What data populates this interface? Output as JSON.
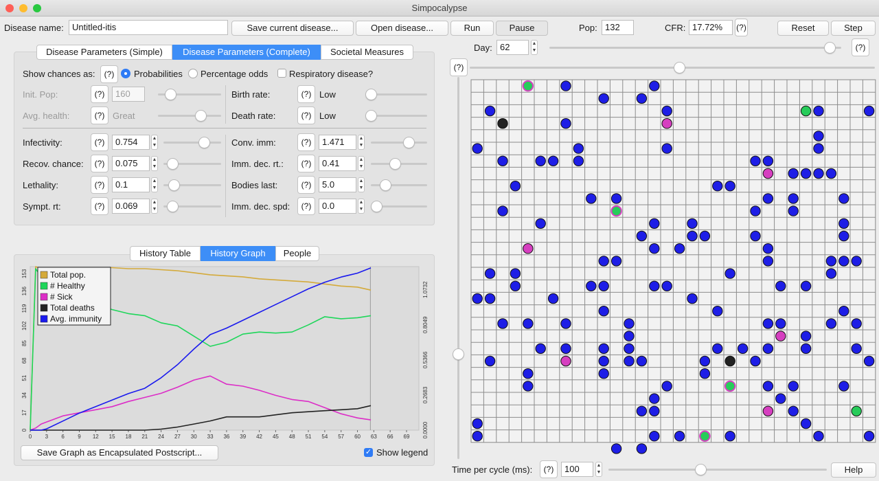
{
  "window": {
    "title": "Simpocalypse",
    "close_color": "#fe5f57",
    "min_color": "#febc2e",
    "max_color": "#28c840"
  },
  "toolbar": {
    "disease_name_label": "Disease name:",
    "disease_name_value": "Untitled-itis",
    "save_label": "Save current disease...",
    "open_label": "Open disease...",
    "run_label": "Run",
    "pause_label": "Pause",
    "pop_label": "Pop:",
    "pop_value": "132",
    "cfr_label": "CFR:",
    "cfr_value": "17.72%",
    "help_q": "(?)",
    "reset_label": "Reset",
    "step_label": "Step"
  },
  "tabs": {
    "simple": "Disease Parameters (Simple)",
    "complete": "Disease Parameters (Complete)",
    "societal": "Societal Measures"
  },
  "params": {
    "show_chances_label": "Show chances as:",
    "q": "(?)",
    "probabilities": "Probabilities",
    "percentage_odds": "Percentage odds",
    "respiratory": "Respiratory disease?",
    "init_pop_label": "Init. Pop:",
    "init_pop_value": "160",
    "avg_health_label": "Avg. health:",
    "avg_health_value": "Great",
    "birth_rate_label": "Birth rate:",
    "birth_rate_value": "Low",
    "death_rate_label": "Death rate:",
    "death_rate_value": "Low",
    "rows": [
      {
        "label": "Infectivity:",
        "value": "0.754",
        "level": 0.754
      },
      {
        "label": "Recov. chance:",
        "value": "0.075",
        "level": 0.075
      },
      {
        "label": "Lethality:",
        "value": "0.1",
        "level": 0.1
      },
      {
        "label": "Sympt. rt:",
        "value": "0.069",
        "level": 0.069
      }
    ],
    "rows_right": [
      {
        "label": "Conv. imm:",
        "value": "1.471",
        "level": 0.73
      },
      {
        "label": "Imm. dec. rt.:",
        "value": "0.41",
        "level": 0.41
      },
      {
        "label": "Bodies last:",
        "value": "5.0",
        "level": 0.2
      },
      {
        "label": "Imm. dec. spd:",
        "value": "0.0",
        "level": 0.0
      }
    ]
  },
  "history_tabs": {
    "table": "History Table",
    "graph": "History Graph",
    "people": "People"
  },
  "chart_data": {
    "type": "line",
    "x_ticks": [
      "0",
      "3",
      "6",
      "9",
      "12",
      "15",
      "18",
      "21",
      "24",
      "27",
      "30",
      "33",
      "36",
      "39",
      "42",
      "45",
      "48",
      "51",
      "54",
      "57",
      "60",
      "63",
      "66",
      "69"
    ],
    "left_ticks": [
      "0",
      "17",
      "34",
      "51",
      "68",
      "85",
      "102",
      "119",
      "136",
      "153"
    ],
    "right_ticks": [
      "0.0000",
      "0.2683",
      "0.5366",
      "0.8049",
      "1.0732"
    ],
    "xlim": [
      0,
      69
    ],
    "ylim_left": [
      0,
      160
    ],
    "ylim_right": [
      0,
      1.25
    ],
    "legend_position": "top-left",
    "series": [
      {
        "name": "Total pop.",
        "color": "#d4aa3a",
        "axis": "left",
        "x": [
          0,
          1,
          2,
          3,
          6,
          9,
          12,
          15,
          18,
          21,
          24,
          27,
          30,
          33,
          36,
          39,
          42,
          45,
          48,
          51,
          54,
          57,
          60,
          63
        ],
        "values": [
          0,
          160,
          158,
          159,
          159,
          159,
          159,
          159,
          158,
          158,
          157,
          156,
          154,
          152,
          151,
          150,
          148,
          147,
          146,
          145,
          143,
          141,
          140,
          137
        ]
      },
      {
        "name": "# Healthy",
        "color": "#1ed65a",
        "axis": "left",
        "x": [
          0,
          1,
          2,
          3,
          6,
          9,
          12,
          15,
          18,
          21,
          24,
          27,
          30,
          33,
          36,
          39,
          42,
          45,
          48,
          51,
          54,
          57,
          60,
          63
        ],
        "values": [
          0,
          158,
          150,
          145,
          135,
          128,
          123,
          118,
          114,
          112,
          105,
          102,
          92,
          82,
          86,
          94,
          96,
          95,
          96,
          103,
          111,
          109,
          110,
          112
        ]
      },
      {
        "name": "# Sick",
        "color": "#dc2dc7",
        "axis": "left",
        "x": [
          0,
          1,
          2,
          3,
          6,
          9,
          12,
          15,
          18,
          21,
          24,
          27,
          30,
          33,
          36,
          39,
          42,
          45,
          48,
          51,
          54,
          57,
          60,
          63
        ],
        "values": [
          0,
          2,
          6,
          8,
          14,
          17,
          20,
          23,
          28,
          32,
          36,
          42,
          49,
          53,
          45,
          43,
          39,
          34,
          30,
          28,
          22,
          16,
          12,
          10
        ]
      },
      {
        "name": "Total deaths",
        "color": "#222222",
        "axis": "left",
        "x": [
          0,
          1,
          2,
          3,
          6,
          9,
          12,
          15,
          18,
          21,
          24,
          27,
          30,
          33,
          36,
          39,
          42,
          45,
          48,
          51,
          54,
          57,
          60,
          63
        ],
        "values": [
          0,
          0,
          0,
          0,
          0,
          0,
          0,
          0,
          0,
          0,
          1,
          3,
          6,
          9,
          13,
          13,
          13,
          15,
          17,
          18,
          19,
          20,
          21,
          24
        ]
      },
      {
        "name": "Avg. immunity",
        "color": "#1a1aee",
        "axis": "right",
        "x": [
          0,
          1,
          2,
          3,
          6,
          9,
          12,
          15,
          18,
          21,
          24,
          27,
          30,
          33,
          36,
          39,
          42,
          45,
          48,
          51,
          54,
          57,
          60,
          63
        ],
        "values": [
          0,
          0,
          0,
          0.01,
          0.07,
          0.13,
          0.18,
          0.23,
          0.28,
          0.32,
          0.4,
          0.5,
          0.62,
          0.73,
          0.78,
          0.84,
          0.9,
          0.96,
          1.02,
          1.08,
          1.13,
          1.17,
          1.2,
          1.24
        ]
      }
    ]
  },
  "graph_footer": {
    "save_eps": "Save Graph as Encapsulated Postscript...",
    "show_legend": "Show legend"
  },
  "right_top": {
    "day_label": "Day:",
    "day_value": "62",
    "day_level": 0.98,
    "q": "(?)",
    "zoom_q": "(?)"
  },
  "grid": {
    "cols": 32,
    "rows": 29,
    "colors": {
      "healthy": "#1e1ee6",
      "sick": "#d63fc0",
      "recovered": "#27cc5a",
      "dead": "#222222",
      "ring_sick": "#d63fc0"
    },
    "people": [
      {
        "c": 4,
        "r": 0,
        "t": "rec"
      },
      {
        "c": 7,
        "r": 0,
        "t": "h"
      },
      {
        "c": 14,
        "r": 0,
        "t": "h"
      },
      {
        "c": 10,
        "r": 1,
        "t": "h"
      },
      {
        "c": 13,
        "r": 1,
        "t": "h"
      },
      {
        "c": 1,
        "r": 2,
        "t": "h"
      },
      {
        "c": 15,
        "r": 2,
        "t": "h"
      },
      {
        "c": 26,
        "r": 2,
        "t": "g"
      },
      {
        "c": 27,
        "r": 2,
        "t": "h"
      },
      {
        "c": 31,
        "r": 2,
        "t": "h"
      },
      {
        "c": 2,
        "r": 3,
        "t": "d"
      },
      {
        "c": 7,
        "r": 3,
        "t": "h"
      },
      {
        "c": 15,
        "r": 3,
        "t": "s"
      },
      {
        "c": 27,
        "r": 4,
        "t": "h"
      },
      {
        "c": 0,
        "r": 5,
        "t": "h"
      },
      {
        "c": 8,
        "r": 5,
        "t": "h"
      },
      {
        "c": 15,
        "r": 5,
        "t": "h"
      },
      {
        "c": 27,
        "r": 5,
        "t": "h"
      },
      {
        "c": 2,
        "r": 6,
        "t": "h"
      },
      {
        "c": 5,
        "r": 6,
        "t": "h"
      },
      {
        "c": 6,
        "r": 6,
        "t": "h"
      },
      {
        "c": 8,
        "r": 6,
        "t": "h"
      },
      {
        "c": 22,
        "r": 6,
        "t": "h"
      },
      {
        "c": 23,
        "r": 6,
        "t": "h"
      },
      {
        "c": 23,
        "r": 7,
        "t": "s"
      },
      {
        "c": 25,
        "r": 7,
        "t": "h"
      },
      {
        "c": 26,
        "r": 7,
        "t": "h"
      },
      {
        "c": 27,
        "r": 7,
        "t": "h"
      },
      {
        "c": 28,
        "r": 7,
        "t": "h"
      },
      {
        "c": 3,
        "r": 8,
        "t": "h"
      },
      {
        "c": 19,
        "r": 8,
        "t": "h"
      },
      {
        "c": 20,
        "r": 8,
        "t": "h"
      },
      {
        "c": 9,
        "r": 9,
        "t": "h"
      },
      {
        "c": 11,
        "r": 9,
        "t": "h"
      },
      {
        "c": 23,
        "r": 9,
        "t": "h"
      },
      {
        "c": 25,
        "r": 9,
        "t": "h"
      },
      {
        "c": 29,
        "r": 9,
        "t": "h"
      },
      {
        "c": 2,
        "r": 10,
        "t": "h"
      },
      {
        "c": 11,
        "r": 10,
        "t": "rec"
      },
      {
        "c": 22,
        "r": 10,
        "t": "h"
      },
      {
        "c": 25,
        "r": 10,
        "t": "h"
      },
      {
        "c": 5,
        "r": 11,
        "t": "h"
      },
      {
        "c": 14,
        "r": 11,
        "t": "h"
      },
      {
        "c": 17,
        "r": 11,
        "t": "h"
      },
      {
        "c": 29,
        "r": 11,
        "t": "h"
      },
      {
        "c": 13,
        "r": 12,
        "t": "h"
      },
      {
        "c": 17,
        "r": 12,
        "t": "h"
      },
      {
        "c": 18,
        "r": 12,
        "t": "h"
      },
      {
        "c": 22,
        "r": 12,
        "t": "h"
      },
      {
        "c": 29,
        "r": 12,
        "t": "h"
      },
      {
        "c": 4,
        "r": 13,
        "t": "s"
      },
      {
        "c": 14,
        "r": 13,
        "t": "h"
      },
      {
        "c": 16,
        "r": 13,
        "t": "h"
      },
      {
        "c": 23,
        "r": 13,
        "t": "h"
      },
      {
        "c": 10,
        "r": 14,
        "t": "h"
      },
      {
        "c": 11,
        "r": 14,
        "t": "h"
      },
      {
        "c": 23,
        "r": 14,
        "t": "h"
      },
      {
        "c": 28,
        "r": 14,
        "t": "h"
      },
      {
        "c": 29,
        "r": 14,
        "t": "h"
      },
      {
        "c": 30,
        "r": 14,
        "t": "h"
      },
      {
        "c": 1,
        "r": 15,
        "t": "h"
      },
      {
        "c": 3,
        "r": 15,
        "t": "h"
      },
      {
        "c": 20,
        "r": 15,
        "t": "h"
      },
      {
        "c": 28,
        "r": 15,
        "t": "h"
      },
      {
        "c": 3,
        "r": 16,
        "t": "h"
      },
      {
        "c": 9,
        "r": 16,
        "t": "h"
      },
      {
        "c": 10,
        "r": 16,
        "t": "h"
      },
      {
        "c": 14,
        "r": 16,
        "t": "h"
      },
      {
        "c": 15,
        "r": 16,
        "t": "h"
      },
      {
        "c": 24,
        "r": 16,
        "t": "h"
      },
      {
        "c": 26,
        "r": 16,
        "t": "h"
      },
      {
        "c": 0,
        "r": 17,
        "t": "h"
      },
      {
        "c": 1,
        "r": 17,
        "t": "h"
      },
      {
        "c": 6,
        "r": 17,
        "t": "h"
      },
      {
        "c": 17,
        "r": 17,
        "t": "h"
      },
      {
        "c": 10,
        "r": 18,
        "t": "h"
      },
      {
        "c": 19,
        "r": 18,
        "t": "h"
      },
      {
        "c": 29,
        "r": 18,
        "t": "h"
      },
      {
        "c": 2,
        "r": 19,
        "t": "h"
      },
      {
        "c": 4,
        "r": 19,
        "t": "h"
      },
      {
        "c": 7,
        "r": 19,
        "t": "h"
      },
      {
        "c": 12,
        "r": 19,
        "t": "h"
      },
      {
        "c": 23,
        "r": 19,
        "t": "h"
      },
      {
        "c": 24,
        "r": 19,
        "t": "h"
      },
      {
        "c": 28,
        "r": 19,
        "t": "h"
      },
      {
        "c": 30,
        "r": 19,
        "t": "h"
      },
      {
        "c": 12,
        "r": 20,
        "t": "h"
      },
      {
        "c": 24,
        "r": 20,
        "t": "s"
      },
      {
        "c": 26,
        "r": 20,
        "t": "h"
      },
      {
        "c": 5,
        "r": 21,
        "t": "h"
      },
      {
        "c": 7,
        "r": 21,
        "t": "h"
      },
      {
        "c": 10,
        "r": 21,
        "t": "h"
      },
      {
        "c": 12,
        "r": 21,
        "t": "h"
      },
      {
        "c": 19,
        "r": 21,
        "t": "h"
      },
      {
        "c": 21,
        "r": 21,
        "t": "h"
      },
      {
        "c": 23,
        "r": 21,
        "t": "h"
      },
      {
        "c": 26,
        "r": 21,
        "t": "h"
      },
      {
        "c": 30,
        "r": 21,
        "t": "h"
      },
      {
        "c": 1,
        "r": 22,
        "t": "h"
      },
      {
        "c": 7,
        "r": 22,
        "t": "s"
      },
      {
        "c": 10,
        "r": 22,
        "t": "h"
      },
      {
        "c": 12,
        "r": 22,
        "t": "h"
      },
      {
        "c": 13,
        "r": 22,
        "t": "h"
      },
      {
        "c": 18,
        "r": 22,
        "t": "h"
      },
      {
        "c": 20,
        "r": 22,
        "t": "d"
      },
      {
        "c": 22,
        "r": 22,
        "t": "h"
      },
      {
        "c": 31,
        "r": 22,
        "t": "h"
      },
      {
        "c": 4,
        "r": 23,
        "t": "h"
      },
      {
        "c": 10,
        "r": 23,
        "t": "h"
      },
      {
        "c": 18,
        "r": 23,
        "t": "h"
      },
      {
        "c": 4,
        "r": 24,
        "t": "h"
      },
      {
        "c": 15,
        "r": 24,
        "t": "h"
      },
      {
        "c": 20,
        "r": 24,
        "t": "rec"
      },
      {
        "c": 23,
        "r": 24,
        "t": "h"
      },
      {
        "c": 25,
        "r": 24,
        "t": "h"
      },
      {
        "c": 29,
        "r": 24,
        "t": "h"
      },
      {
        "c": 14,
        "r": 25,
        "t": "h"
      },
      {
        "c": 24,
        "r": 25,
        "t": "h"
      },
      {
        "c": 13,
        "r": 26,
        "t": "h"
      },
      {
        "c": 14,
        "r": 26,
        "t": "h"
      },
      {
        "c": 23,
        "r": 26,
        "t": "s"
      },
      {
        "c": 25,
        "r": 26,
        "t": "h"
      },
      {
        "c": 30,
        "r": 26,
        "t": "g"
      },
      {
        "c": 0,
        "r": 27,
        "t": "h"
      },
      {
        "c": 26,
        "r": 27,
        "t": "h"
      },
      {
        "c": 0,
        "r": 28,
        "t": "h"
      },
      {
        "c": 14,
        "r": 28,
        "t": "h"
      },
      {
        "c": 16,
        "r": 28,
        "t": "h"
      },
      {
        "c": 18,
        "r": 28,
        "t": "rec"
      },
      {
        "c": 20,
        "r": 28,
        "t": "h"
      },
      {
        "c": 27,
        "r": 28,
        "t": "h"
      },
      {
        "c": 31,
        "r": 28,
        "t": "h"
      },
      {
        "c": 11,
        "r": 29,
        "t": "h"
      },
      {
        "c": 13,
        "r": 29,
        "t": "h"
      }
    ]
  },
  "bottom": {
    "time_label": "Time per cycle (ms):",
    "q": "(?)",
    "time_value": "100",
    "time_level": 0.42,
    "help_label": "Help"
  }
}
